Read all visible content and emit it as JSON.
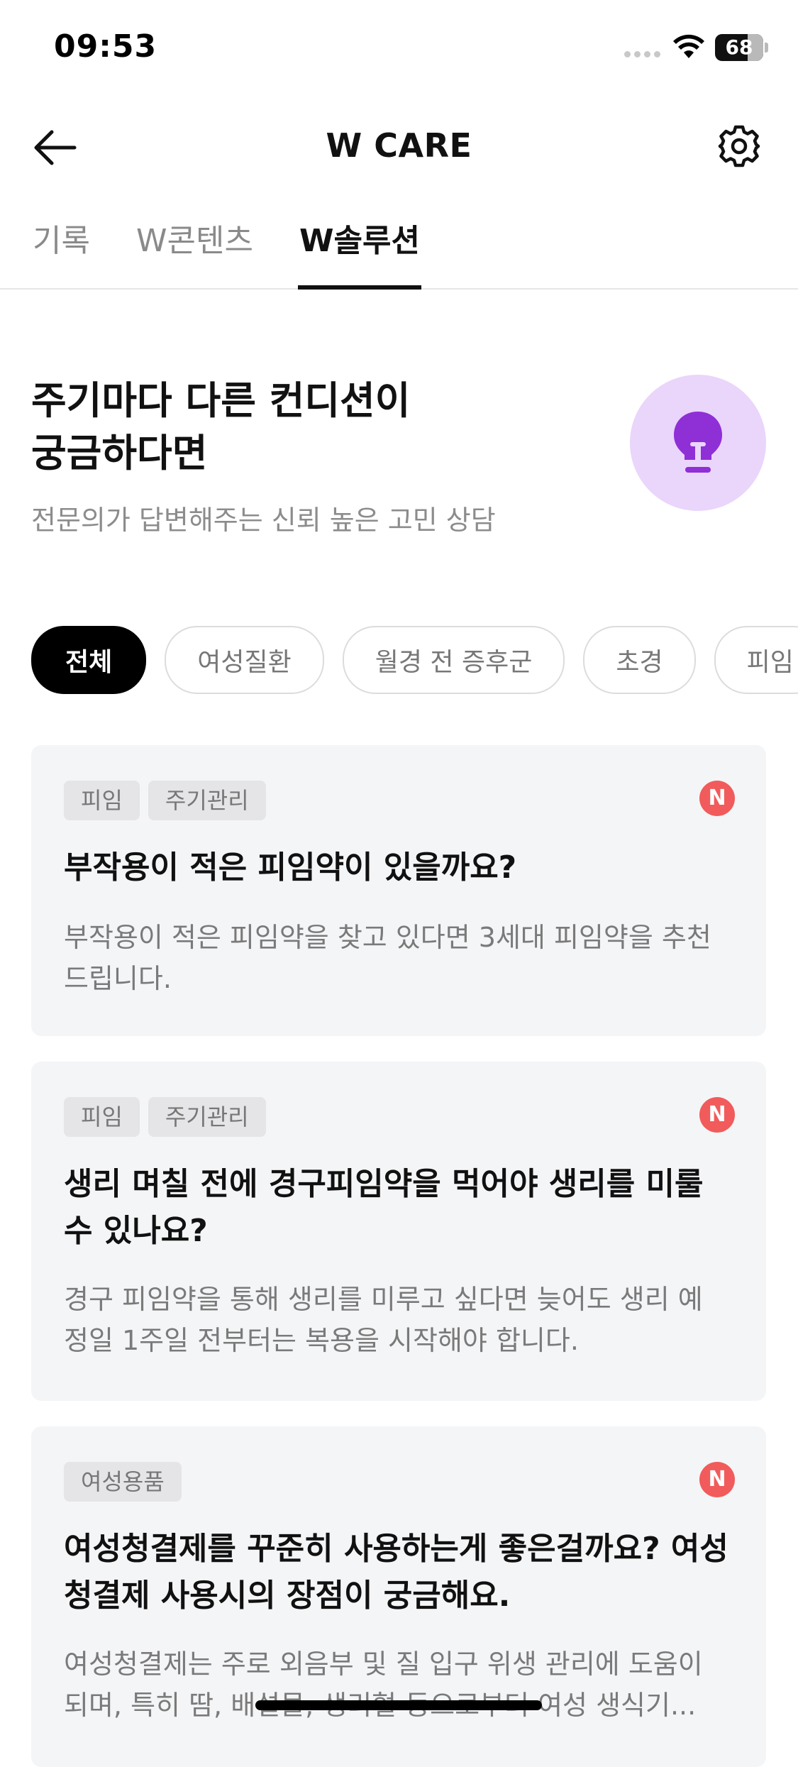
{
  "status_bar": {
    "time": "09:53",
    "battery": "68"
  },
  "header": {
    "title": "W CARE",
    "back_icon": "arrow-left-icon",
    "settings_icon": "gear-icon"
  },
  "tabs": [
    {
      "label": "기록",
      "active": false
    },
    {
      "label": "W콘텐츠",
      "active": false
    },
    {
      "label": "W솔루션",
      "active": true
    }
  ],
  "hero": {
    "title_line1": "주기마다 다른 컨디션이",
    "title_line2": "궁금하다면",
    "subtitle": "전문의가 답변해주는 신뢰 높은 고민 상담",
    "icon": "lightbulb-icon",
    "icon_bg_color": "#ead5fb",
    "icon_color": "#8f2fd6"
  },
  "chips": [
    {
      "label": "전체",
      "active": true
    },
    {
      "label": "여성질환",
      "active": false
    },
    {
      "label": "월경 전 증후군",
      "active": false
    },
    {
      "label": "초경",
      "active": false
    },
    {
      "label": "피임",
      "active": false
    }
  ],
  "cards": [
    {
      "tags": [
        "피임",
        "주기관리"
      ],
      "badge": "N",
      "title": "부작용이 적은 피임약이 있을까요?",
      "description_line1": "부작용이 적은 피임약을 찾고 있다면 3세대 피임약을 추천",
      "description_line2": "드립니다."
    },
    {
      "tags": [
        "피임",
        "주기관리"
      ],
      "badge": "N",
      "title_line1": "생리 며칠 전에 경구피임약을 먹어야 생리를 미룰",
      "title_line2": "수 있나요?",
      "description_line1": "경구 피임약을 통해 생리를 미루고 싶다면 늦어도 생리 예",
      "description_line2": "정일 1주일 전부터는 복용을 시작해야 합니다."
    },
    {
      "tags": [
        "여성용품"
      ],
      "badge": "N",
      "title_line1": "여성청결제를 꾸준히 사용하는게 좋은걸까요? 여성",
      "title_line2": "청결제 사용시의 장점이 궁금해요.",
      "description_line1": "여성청결제는 주로 외음부 및 질 입구 위생 관리에 도움이",
      "description_line2": "되며, 특히 땀, 배설물, 생리혈 등으로부터 여성 생식기..."
    }
  ],
  "colors": {
    "badge": "#f15b5b",
    "card_bg": "#f4f5f7",
    "active_chip": "#000000"
  }
}
